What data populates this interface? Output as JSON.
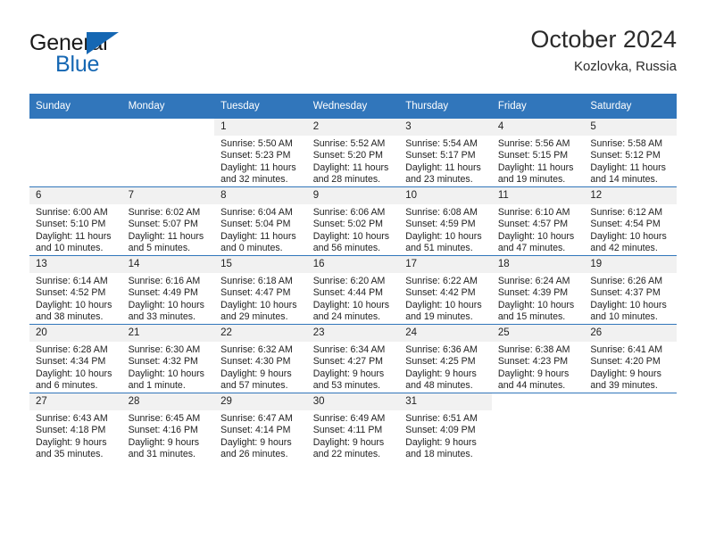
{
  "brand": {
    "name_top": "General",
    "name_bottom": "Blue",
    "accent_color": "#1567b3"
  },
  "header": {
    "title": "October 2024",
    "location": "Kozlovka, Russia"
  },
  "theme": {
    "header_blue": "#3176bb",
    "daynum_band": "#f1f1f1"
  },
  "weekdays": [
    "Sunday",
    "Monday",
    "Tuesday",
    "Wednesday",
    "Thursday",
    "Friday",
    "Saturday"
  ],
  "weeks": [
    [
      {
        "day": "",
        "blank": true
      },
      {
        "day": "",
        "blank": true
      },
      {
        "day": "1",
        "sunrise": "Sunrise: 5:50 AM",
        "sunset": "Sunset: 5:23 PM",
        "daylight1": "Daylight: 11 hours",
        "daylight2": "and 32 minutes."
      },
      {
        "day": "2",
        "sunrise": "Sunrise: 5:52 AM",
        "sunset": "Sunset: 5:20 PM",
        "daylight1": "Daylight: 11 hours",
        "daylight2": "and 28 minutes."
      },
      {
        "day": "3",
        "sunrise": "Sunrise: 5:54 AM",
        "sunset": "Sunset: 5:17 PM",
        "daylight1": "Daylight: 11 hours",
        "daylight2": "and 23 minutes."
      },
      {
        "day": "4",
        "sunrise": "Sunrise: 5:56 AM",
        "sunset": "Sunset: 5:15 PM",
        "daylight1": "Daylight: 11 hours",
        "daylight2": "and 19 minutes."
      },
      {
        "day": "5",
        "sunrise": "Sunrise: 5:58 AM",
        "sunset": "Sunset: 5:12 PM",
        "daylight1": "Daylight: 11 hours",
        "daylight2": "and 14 minutes."
      }
    ],
    [
      {
        "day": "6",
        "sunrise": "Sunrise: 6:00 AM",
        "sunset": "Sunset: 5:10 PM",
        "daylight1": "Daylight: 11 hours",
        "daylight2": "and 10 minutes."
      },
      {
        "day": "7",
        "sunrise": "Sunrise: 6:02 AM",
        "sunset": "Sunset: 5:07 PM",
        "daylight1": "Daylight: 11 hours",
        "daylight2": "and 5 minutes."
      },
      {
        "day": "8",
        "sunrise": "Sunrise: 6:04 AM",
        "sunset": "Sunset: 5:04 PM",
        "daylight1": "Daylight: 11 hours",
        "daylight2": "and 0 minutes."
      },
      {
        "day": "9",
        "sunrise": "Sunrise: 6:06 AM",
        "sunset": "Sunset: 5:02 PM",
        "daylight1": "Daylight: 10 hours",
        "daylight2": "and 56 minutes."
      },
      {
        "day": "10",
        "sunrise": "Sunrise: 6:08 AM",
        "sunset": "Sunset: 4:59 PM",
        "daylight1": "Daylight: 10 hours",
        "daylight2": "and 51 minutes."
      },
      {
        "day": "11",
        "sunrise": "Sunrise: 6:10 AM",
        "sunset": "Sunset: 4:57 PM",
        "daylight1": "Daylight: 10 hours",
        "daylight2": "and 47 minutes."
      },
      {
        "day": "12",
        "sunrise": "Sunrise: 6:12 AM",
        "sunset": "Sunset: 4:54 PM",
        "daylight1": "Daylight: 10 hours",
        "daylight2": "and 42 minutes."
      }
    ],
    [
      {
        "day": "13",
        "sunrise": "Sunrise: 6:14 AM",
        "sunset": "Sunset: 4:52 PM",
        "daylight1": "Daylight: 10 hours",
        "daylight2": "and 38 minutes."
      },
      {
        "day": "14",
        "sunrise": "Sunrise: 6:16 AM",
        "sunset": "Sunset: 4:49 PM",
        "daylight1": "Daylight: 10 hours",
        "daylight2": "and 33 minutes."
      },
      {
        "day": "15",
        "sunrise": "Sunrise: 6:18 AM",
        "sunset": "Sunset: 4:47 PM",
        "daylight1": "Daylight: 10 hours",
        "daylight2": "and 29 minutes."
      },
      {
        "day": "16",
        "sunrise": "Sunrise: 6:20 AM",
        "sunset": "Sunset: 4:44 PM",
        "daylight1": "Daylight: 10 hours",
        "daylight2": "and 24 minutes."
      },
      {
        "day": "17",
        "sunrise": "Sunrise: 6:22 AM",
        "sunset": "Sunset: 4:42 PM",
        "daylight1": "Daylight: 10 hours",
        "daylight2": "and 19 minutes."
      },
      {
        "day": "18",
        "sunrise": "Sunrise: 6:24 AM",
        "sunset": "Sunset: 4:39 PM",
        "daylight1": "Daylight: 10 hours",
        "daylight2": "and 15 minutes."
      },
      {
        "day": "19",
        "sunrise": "Sunrise: 6:26 AM",
        "sunset": "Sunset: 4:37 PM",
        "daylight1": "Daylight: 10 hours",
        "daylight2": "and 10 minutes."
      }
    ],
    [
      {
        "day": "20",
        "sunrise": "Sunrise: 6:28 AM",
        "sunset": "Sunset: 4:34 PM",
        "daylight1": "Daylight: 10 hours",
        "daylight2": "and 6 minutes."
      },
      {
        "day": "21",
        "sunrise": "Sunrise: 6:30 AM",
        "sunset": "Sunset: 4:32 PM",
        "daylight1": "Daylight: 10 hours",
        "daylight2": "and 1 minute."
      },
      {
        "day": "22",
        "sunrise": "Sunrise: 6:32 AM",
        "sunset": "Sunset: 4:30 PM",
        "daylight1": "Daylight: 9 hours",
        "daylight2": "and 57 minutes."
      },
      {
        "day": "23",
        "sunrise": "Sunrise: 6:34 AM",
        "sunset": "Sunset: 4:27 PM",
        "daylight1": "Daylight: 9 hours",
        "daylight2": "and 53 minutes."
      },
      {
        "day": "24",
        "sunrise": "Sunrise: 6:36 AM",
        "sunset": "Sunset: 4:25 PM",
        "daylight1": "Daylight: 9 hours",
        "daylight2": "and 48 minutes."
      },
      {
        "day": "25",
        "sunrise": "Sunrise: 6:38 AM",
        "sunset": "Sunset: 4:23 PM",
        "daylight1": "Daylight: 9 hours",
        "daylight2": "and 44 minutes."
      },
      {
        "day": "26",
        "sunrise": "Sunrise: 6:41 AM",
        "sunset": "Sunset: 4:20 PM",
        "daylight1": "Daylight: 9 hours",
        "daylight2": "and 39 minutes."
      }
    ],
    [
      {
        "day": "27",
        "sunrise": "Sunrise: 6:43 AM",
        "sunset": "Sunset: 4:18 PM",
        "daylight1": "Daylight: 9 hours",
        "daylight2": "and 35 minutes."
      },
      {
        "day": "28",
        "sunrise": "Sunrise: 6:45 AM",
        "sunset": "Sunset: 4:16 PM",
        "daylight1": "Daylight: 9 hours",
        "daylight2": "and 31 minutes."
      },
      {
        "day": "29",
        "sunrise": "Sunrise: 6:47 AM",
        "sunset": "Sunset: 4:14 PM",
        "daylight1": "Daylight: 9 hours",
        "daylight2": "and 26 minutes."
      },
      {
        "day": "30",
        "sunrise": "Sunrise: 6:49 AM",
        "sunset": "Sunset: 4:11 PM",
        "daylight1": "Daylight: 9 hours",
        "daylight2": "and 22 minutes."
      },
      {
        "day": "31",
        "sunrise": "Sunrise: 6:51 AM",
        "sunset": "Sunset: 4:09 PM",
        "daylight1": "Daylight: 9 hours",
        "daylight2": "and 18 minutes."
      },
      {
        "day": "",
        "blank": true
      },
      {
        "day": "",
        "blank": true
      }
    ]
  ]
}
